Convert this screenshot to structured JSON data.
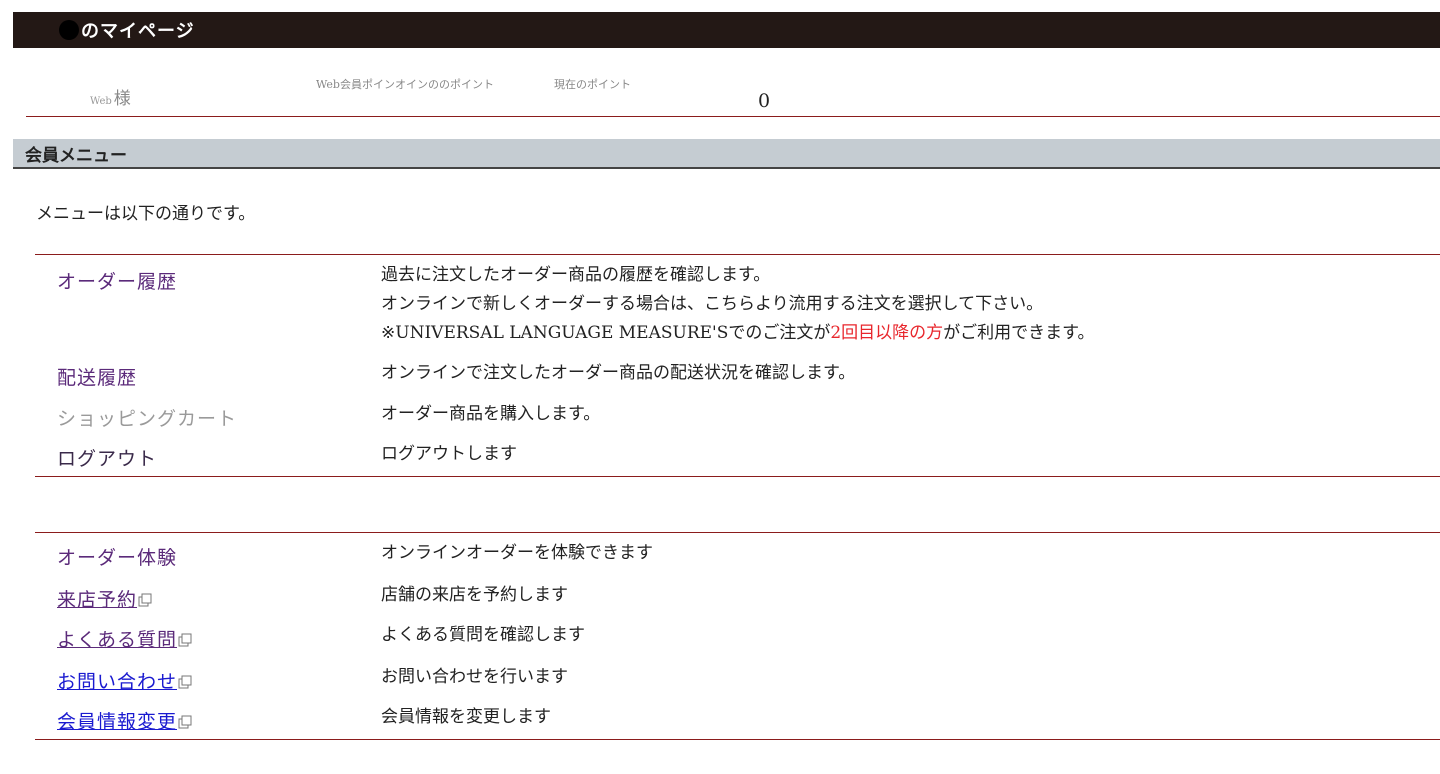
{
  "header": {
    "title": "のマイページ"
  },
  "points": {
    "member_prefix": "Web",
    "member_suffix": "様",
    "label_web_points": "Web会員ポインオインののポイント",
    "label_current_points": "現在のポイント",
    "current_points_value": "0"
  },
  "section": {
    "title": "会員メニュー"
  },
  "intro": "メニューは以下の通りです。",
  "menu1": [
    {
      "label": "オーダー履歴",
      "desc_lines": [
        "過去に注文したオーダー商品の履歴を確認します。",
        "オンラインで新しくオーダーする場合は、こちらより流用する注文を選択して下さい。"
      ],
      "note_before": "※UNIVERSAL LANGUAGE MEASURE'Sでのご注文が",
      "note_red": "2回目以降の方",
      "note_after": "がご利用できます。"
    },
    {
      "label": "配送履歴",
      "desc": "オンラインで注文したオーダー商品の配送状況を確認します。"
    },
    {
      "label": "ショッピングカート",
      "desc": "オーダー商品を購入します。"
    },
    {
      "label": "ログアウト",
      "desc": "ログアウトします"
    }
  ],
  "menu2": [
    {
      "label": "オーダー体験",
      "desc": "オンラインオーダーを体験できます"
    },
    {
      "label": "来店予約",
      "desc": "店舗の来店を予約します"
    },
    {
      "label": "よくある質問",
      "desc": "よくある質問を確認します"
    },
    {
      "label": "お問い合わせ",
      "desc": "お問い合わせを行います"
    },
    {
      "label": "会員情報変更",
      "desc": "会員情報を変更します"
    }
  ],
  "colors": {
    "header_bg": "#231815",
    "section_bg": "#c5ccd2",
    "divider": "#8b1c1c",
    "link_purple": "#5b2a7a",
    "link_blue": "#1a1ad0",
    "highlight_red": "#e8262c"
  },
  "icons": {
    "external_link": "external-link-icon"
  }
}
